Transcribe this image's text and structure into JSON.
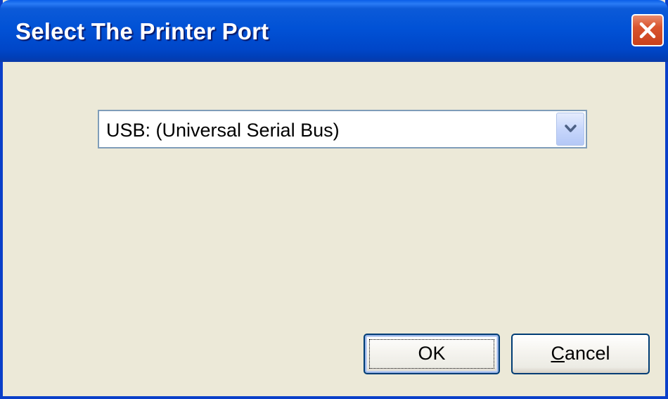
{
  "window": {
    "title": "Select The Printer Port"
  },
  "icons": {
    "close": "close-icon",
    "dropdown": "chevron-down-icon"
  },
  "port_select": {
    "selected_value": "USB: (Universal Serial Bus)"
  },
  "buttons": {
    "ok_label": "OK",
    "cancel_mnemonic": "C",
    "cancel_rest": "ancel"
  },
  "colors": {
    "titlebar": "#0152d6",
    "dialog_background": "#ece9d8",
    "close_button": "#d9542e",
    "button_border": "#003c74"
  }
}
